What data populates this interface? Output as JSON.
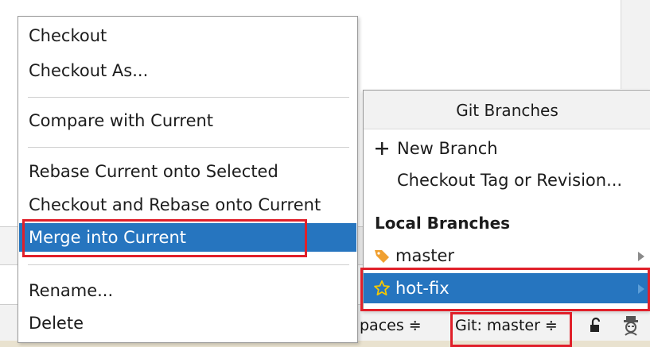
{
  "context_menu": {
    "items": [
      {
        "label": "Checkout"
      },
      {
        "label": "Checkout As..."
      },
      {
        "label": "Compare with Current"
      },
      {
        "label": "Rebase Current onto Selected"
      },
      {
        "label": "Checkout and Rebase onto Current"
      },
      {
        "label": "Merge into Current"
      },
      {
        "label": "Rename..."
      },
      {
        "label": "Delete"
      }
    ],
    "selected_index": 5
  },
  "git_branches": {
    "title": "Git Branches",
    "actions": [
      {
        "label": "New Branch",
        "icon": "plus-icon"
      },
      {
        "label": "Checkout Tag or Revision..."
      }
    ],
    "local_heading": "Local Branches",
    "local": [
      {
        "name": "master",
        "icon": "tag-icon"
      },
      {
        "name": "hot-fix",
        "icon": "star-outline-icon"
      }
    ]
  },
  "status_bar": {
    "spaces_label": "paces ≑",
    "git_label": "Git: master ≑"
  },
  "colors": {
    "selection": "#2675bf",
    "highlight": "#e0202a",
    "tag": "#f0a030",
    "star": "#f5c800"
  }
}
